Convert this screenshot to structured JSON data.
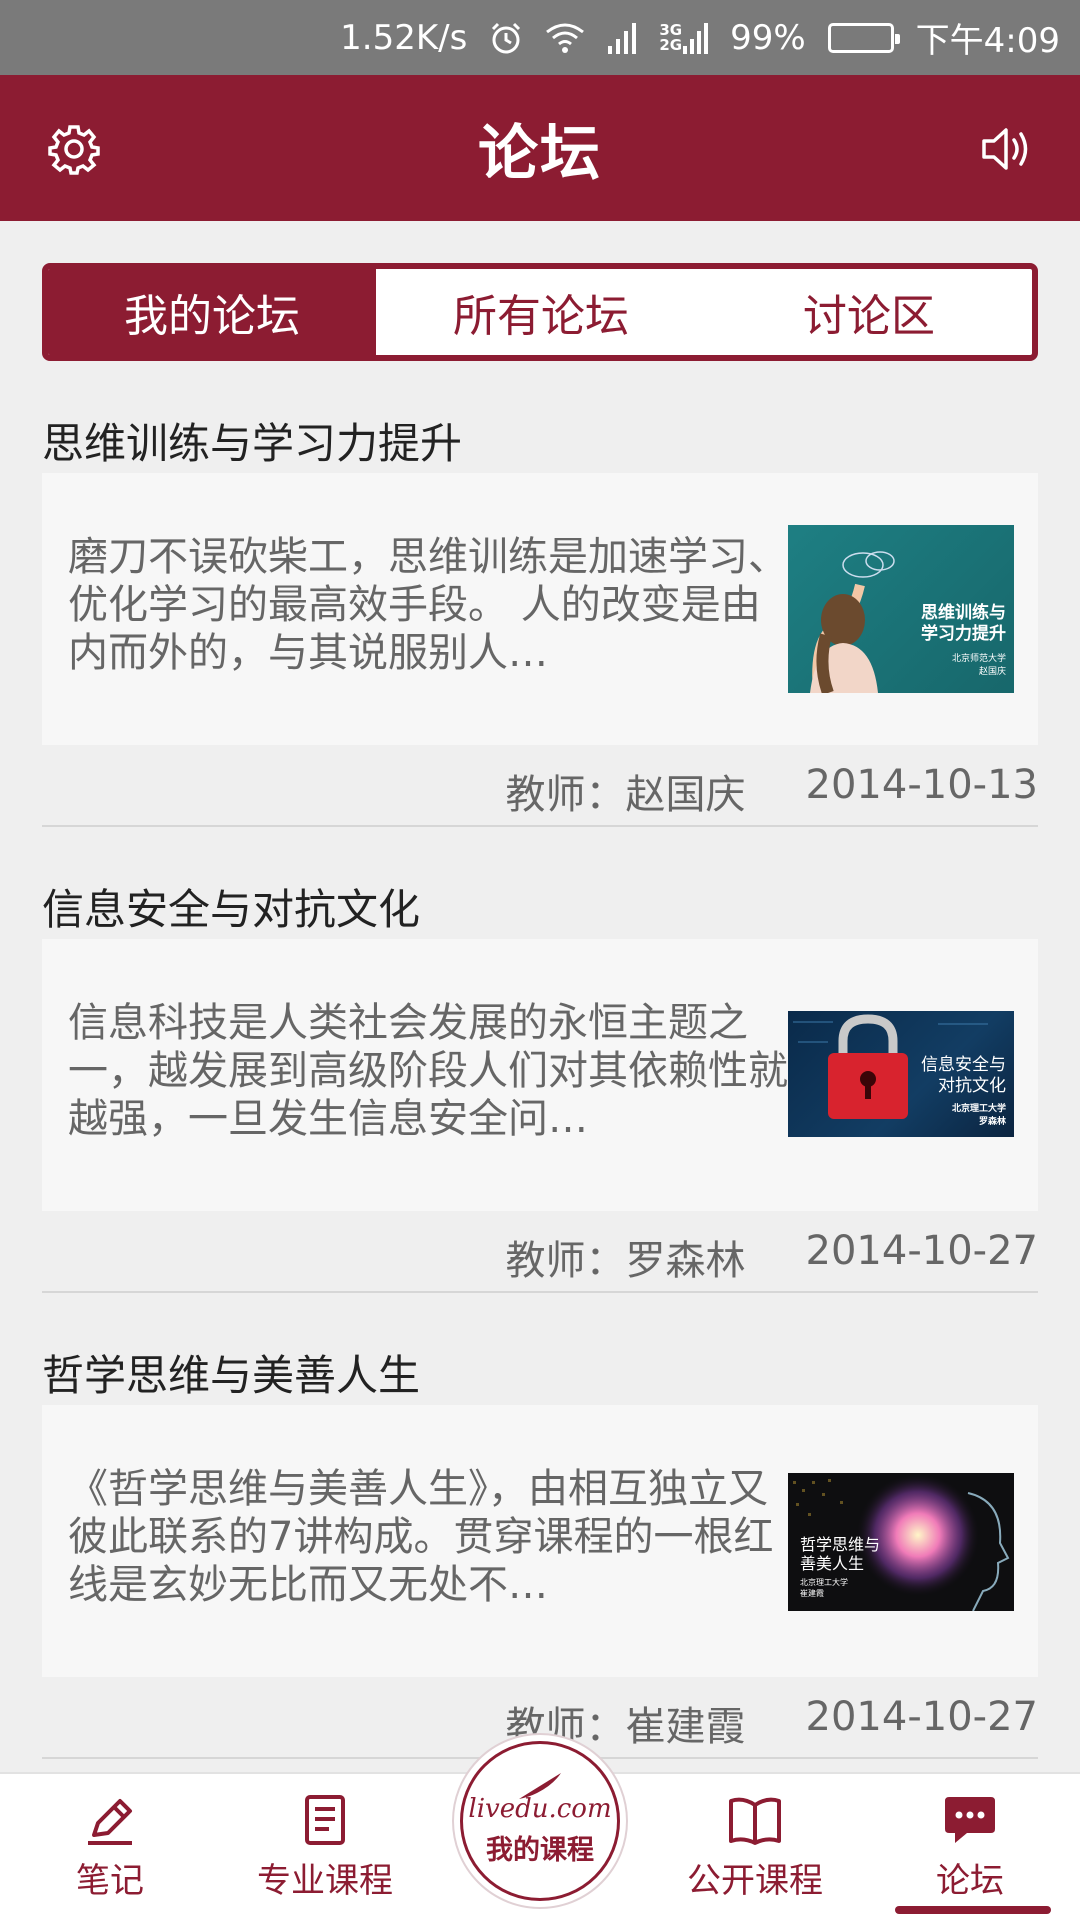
{
  "status_bar": {
    "speed": "1.52K/s",
    "net_3g": "3G",
    "net_2g": "2G",
    "battery": "99%",
    "time": "下午4:09"
  },
  "header": {
    "title": "论坛",
    "left_icon": "gear-icon",
    "right_icon": "speaker-icon"
  },
  "tabs": [
    {
      "label": "我的论坛",
      "active": true
    },
    {
      "label": "所有论坛",
      "active": false
    },
    {
      "label": "讨论区",
      "active": false
    }
  ],
  "forums": [
    {
      "title": "思维训练与学习力提升",
      "summary": "磨刀不误砍柴工，思维训练是加速学习、优化学习的最高效手段。 人的改变是由内而外的，与其说服别人…",
      "thumb_title_1": "思维训练与",
      "thumb_title_2": "学习力提升",
      "thumb_sub_1": "北京师范大学",
      "thumb_sub_2": "赵国庆",
      "teacher": "教师：赵国庆",
      "date": "2014-10-13"
    },
    {
      "title": "信息安全与对抗文化",
      "summary": "信息科技是人类社会发展的永恒主题之一，越发展到高级阶段人们对其依赖性就越强，一旦发生信息安全问…",
      "thumb_title_1": "信息安全与",
      "thumb_title_2": "对抗文化",
      "thumb_sub_1": "北京理工大学",
      "thumb_sub_2": "罗森林",
      "teacher": "教师：罗森林",
      "date": "2014-10-27"
    },
    {
      "title": "哲学思维与美善人生",
      "summary": "《哲学思维与美善人生》，由相互独立又彼此联系的7讲构成。贯穿课程的一根红线是玄妙无比而又无处不…",
      "thumb_title_1": "哲学思维与",
      "thumb_title_2": "善美人生",
      "thumb_sub_1": "北京理工大学",
      "thumb_sub_2": "崔建霞",
      "teacher": "教师：崔建霞",
      "date": "2014-10-27"
    }
  ],
  "bottom_nav": {
    "notes": "笔记",
    "pro_courses": "专业课程",
    "my_courses": "我的课程",
    "brand": "livedu.com",
    "open_courses": "公开课程",
    "forum": "论坛"
  },
  "colors": {
    "brand": "#8c1c32",
    "status_bar": "#7a7a7a",
    "background": "#efefef"
  }
}
